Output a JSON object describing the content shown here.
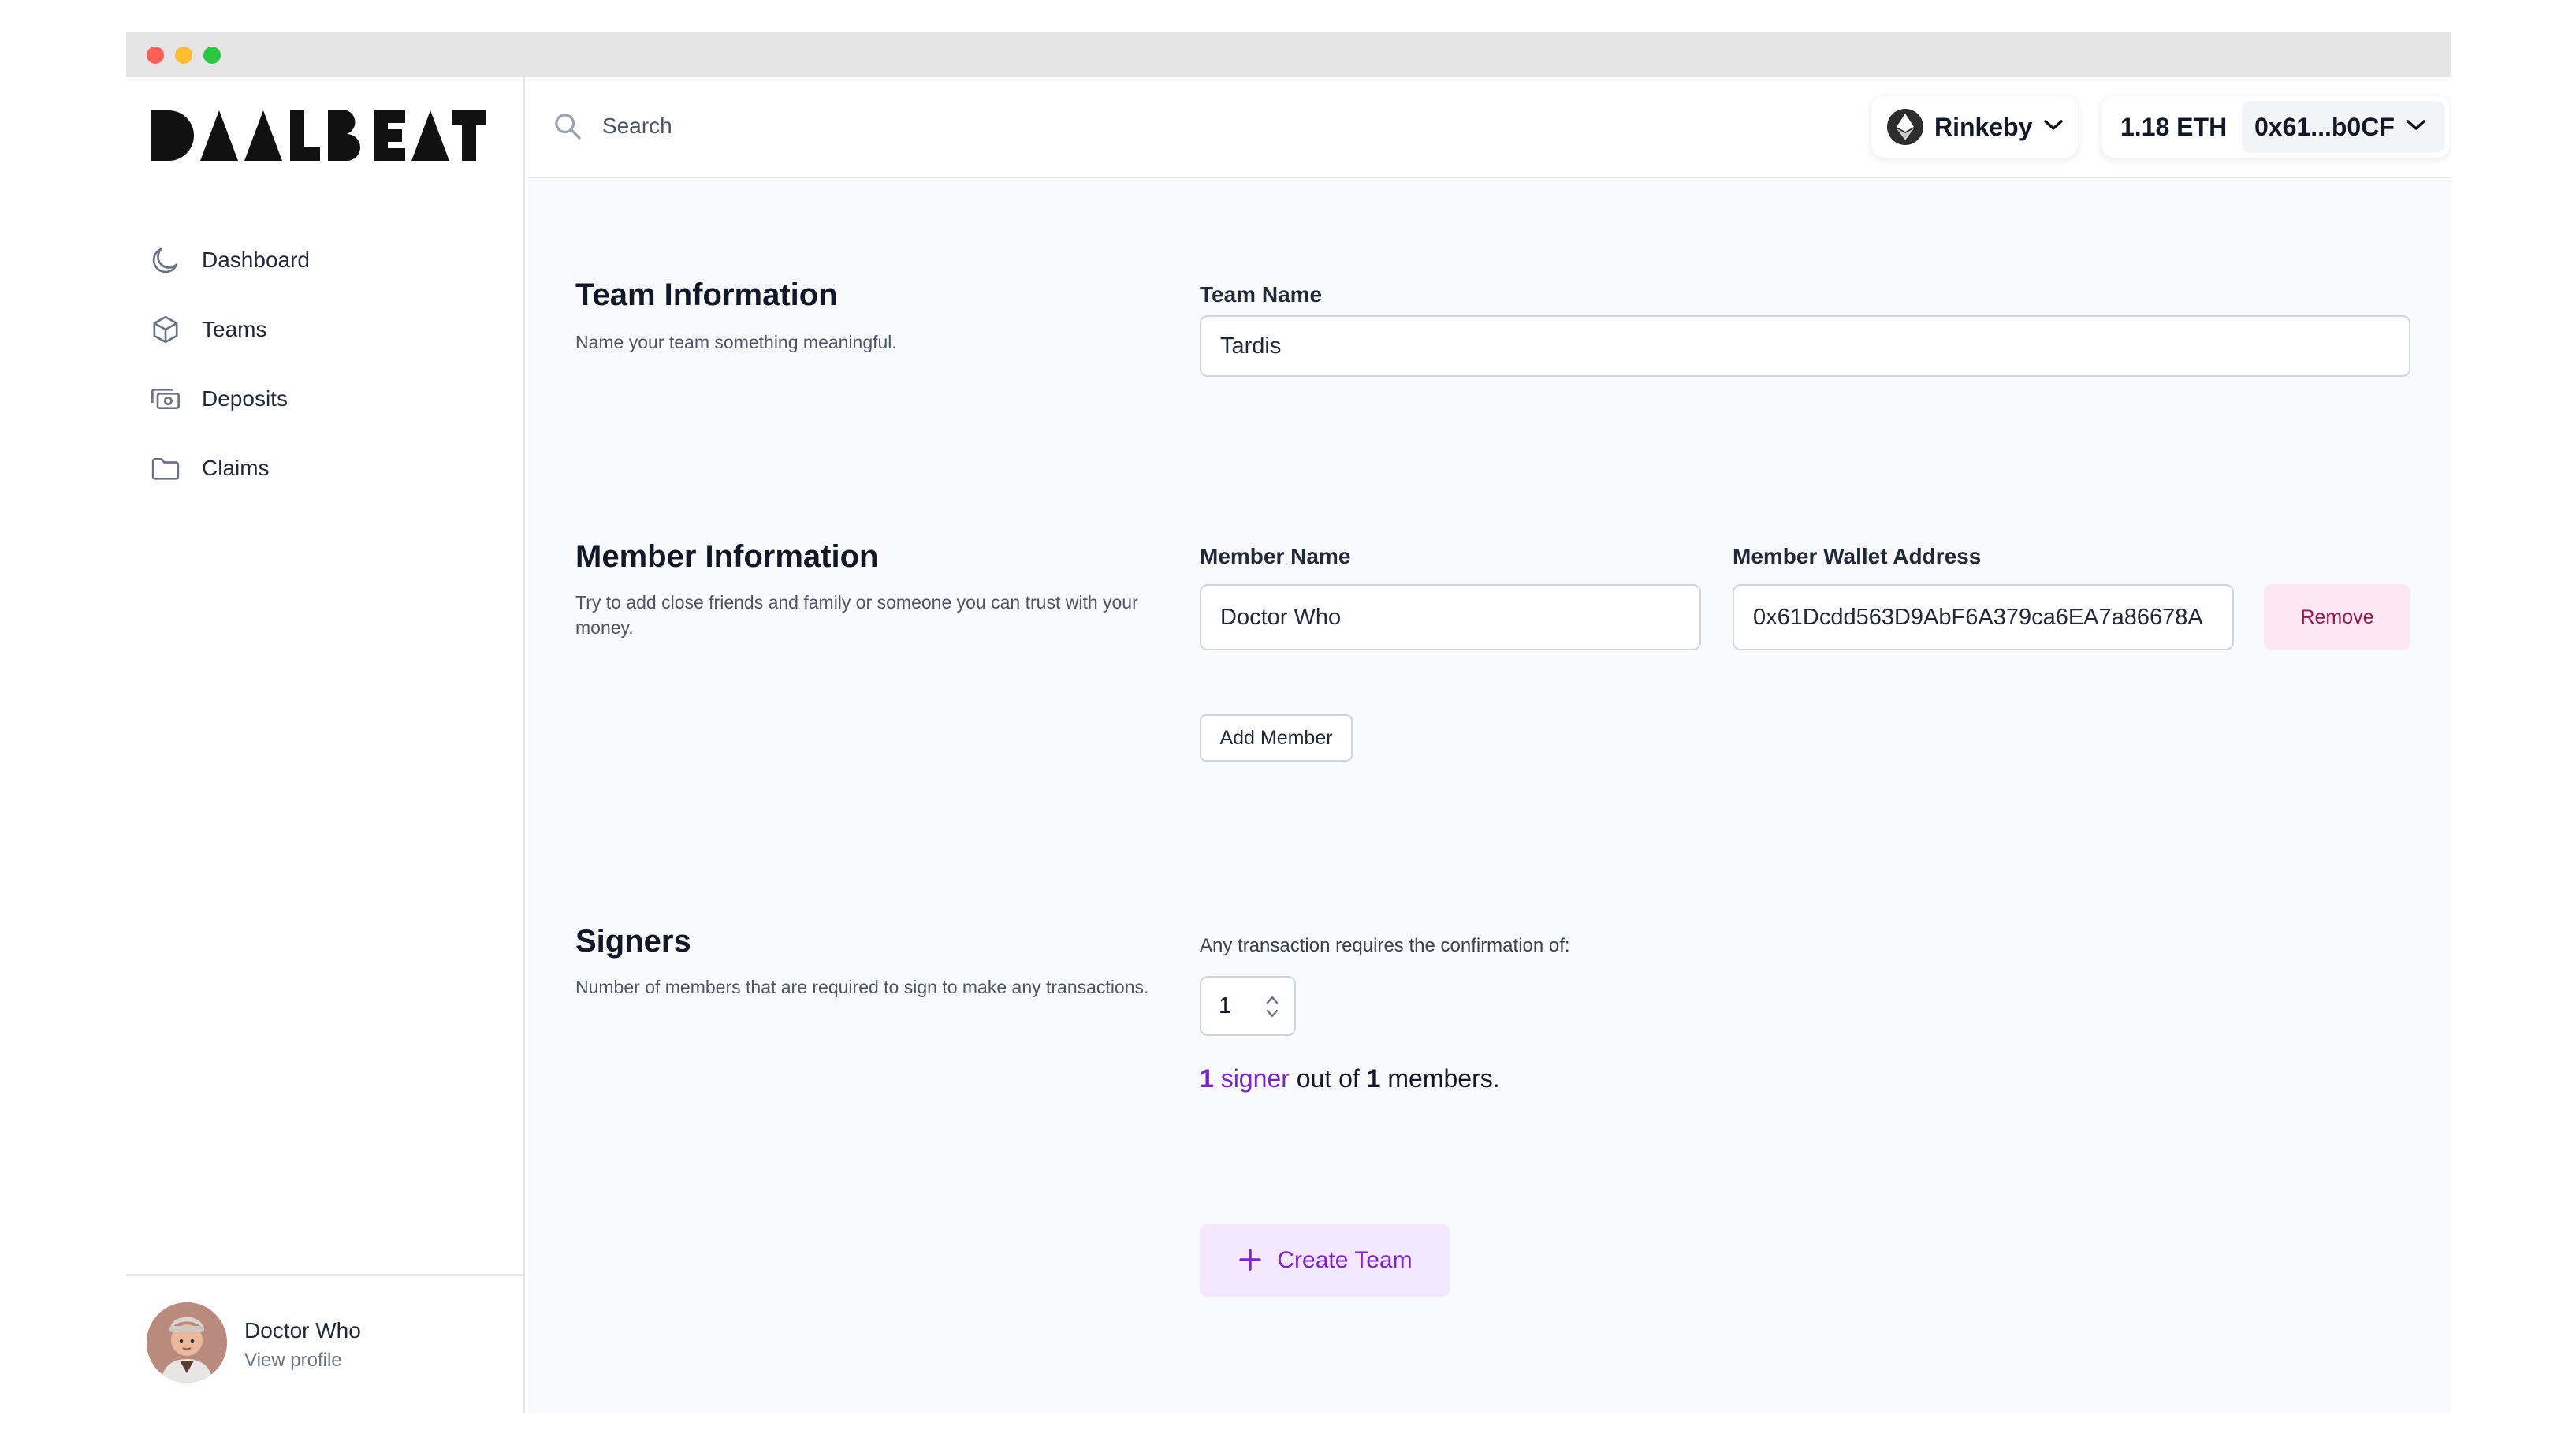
{
  "app": {
    "logo_text": "DAALBEAT"
  },
  "sidebar": {
    "items": [
      {
        "label": "Dashboard",
        "icon": "moon-icon"
      },
      {
        "label": "Teams",
        "icon": "cube-icon"
      },
      {
        "label": "Deposits",
        "icon": "cash-icon"
      },
      {
        "label": "Claims",
        "icon": "folder-icon"
      }
    ],
    "profile": {
      "name": "Doctor Who",
      "link": "View profile"
    }
  },
  "header": {
    "search_placeholder": "Search",
    "network": "Rinkeby",
    "balance": "1.18 ETH",
    "address": "0x61...b0CF"
  },
  "team_info": {
    "title": "Team Information",
    "description": "Name your team something meaningful.",
    "field_label": "Team Name",
    "value": "Tardis"
  },
  "member_info": {
    "title": "Member Information",
    "description": "Try to add close friends and family or someone you can trust with your money.",
    "name_label": "Member Name",
    "wallet_label": "Member Wallet Address",
    "members": [
      {
        "name": "Doctor Who",
        "wallet": "0x61Dcdd563D9AbF6A379ca6EA7a86678A"
      }
    ],
    "remove_label": "Remove",
    "add_label": "Add Member"
  },
  "signers": {
    "title": "Signers",
    "description": "Number of members that are required to sign to make any transactions.",
    "confirm_text": "Any transaction requires the confirmation of:",
    "value": "1",
    "summary": {
      "count": "1",
      "signer_word": "signer",
      "middle": "out of",
      "total": "1",
      "end": "members."
    }
  },
  "actions": {
    "create_label": "Create Team"
  },
  "colors": {
    "accent": "#7e22ce",
    "accent_bg": "#f3e8ff",
    "danger_bg": "#fce7f3",
    "danger_text": "#9d174d"
  }
}
